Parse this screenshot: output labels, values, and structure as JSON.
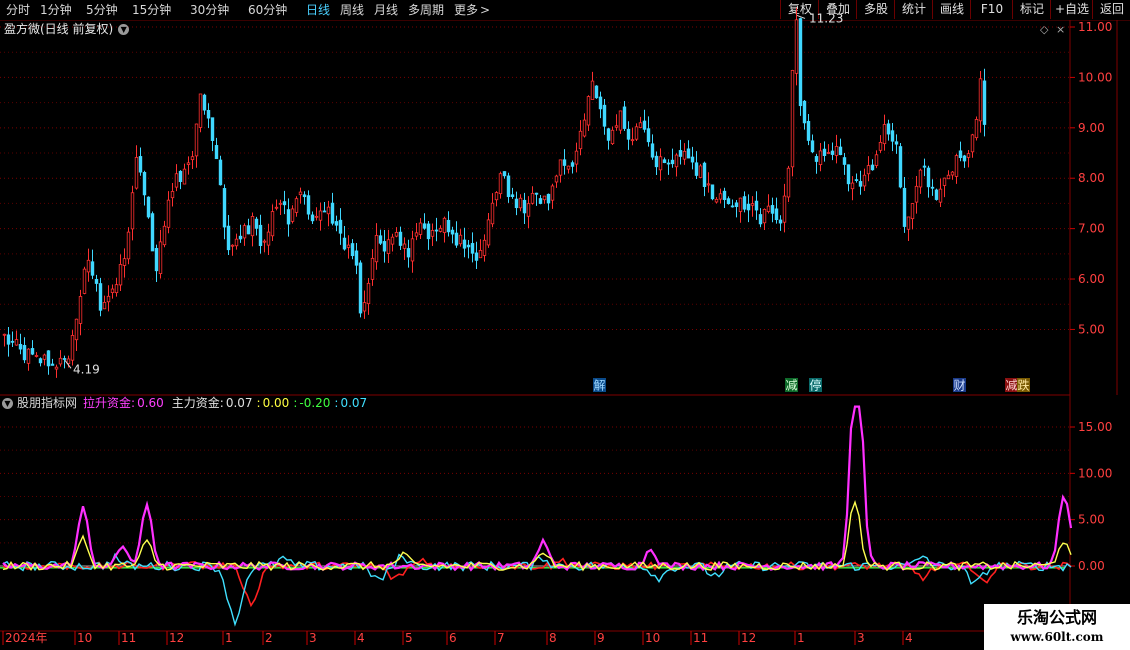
{
  "toolbar": {
    "periods": [
      "分时",
      "1分钟",
      "5分钟",
      "15分钟",
      "30分钟",
      "60分钟",
      "日线",
      "周线",
      "月线",
      "多周期",
      "更多"
    ],
    "active_period": "日线",
    "more_arrow": ">",
    "buttons": [
      "复权",
      "叠加",
      "多股",
      "统计",
      "画线",
      "F10",
      "标记",
      "+自选",
      "返回"
    ]
  },
  "main_panel": {
    "title": "盈方微(日线 前复权)",
    "price_high_label": "11.23",
    "price_low_label": "4.19",
    "event_markers": [
      {
        "label": "解",
        "bg": "#0a4a8a",
        "color": "#9fd8ff",
        "index": 149
      },
      {
        "label": "减",
        "bg": "#0e6a2a",
        "color": "#d8ffd8",
        "index": 197
      },
      {
        "label": "停",
        "bg": "#0a6a6a",
        "color": "#d8ffff",
        "index": 203
      },
      {
        "label": "财",
        "bg": "#1a3a8a",
        "color": "#cfe0ff",
        "index": 239
      },
      {
        "label": "减",
        "bg": "#8a1010",
        "color": "#ffd0d0",
        "index": 252
      },
      {
        "label": "跌",
        "bg": "#7a5a00",
        "color": "#ffe8a0",
        "index": 255
      }
    ]
  },
  "indicator_panel": {
    "name": "股朋指标网",
    "lashen_label": "拉升资金:",
    "lashen_value": "0.60",
    "zhuli_label": "主力资金:",
    "zhuli_value": "0.07",
    "sep1": ":",
    "v3": "0.00",
    "sep2": ":",
    "v4": "-0.20",
    "sep3": ":",
    "v5": "0.07"
  },
  "watermark": {
    "line1": "乐淘公式网",
    "line2": "www.60lt.com"
  },
  "chart_data": {
    "type": "candlestick",
    "axis_main": {
      "ticks": [
        "5.00",
        "6.00",
        "7.00",
        "8.00",
        "9.00",
        "10.00",
        "11.00"
      ],
      "ylim": [
        4.1,
        11.4
      ]
    },
    "axis_indicator": {
      "ticks": [
        "0.00",
        "5.00",
        "10.00",
        "15.00"
      ],
      "ylim": [
        -6.5,
        17.5
      ]
    },
    "x_labels": [
      "2024年",
      "10",
      "11",
      "12",
      "1",
      "2",
      "3",
      "4",
      "5",
      "6",
      "7",
      "8",
      "9",
      "10",
      "11",
      "12",
      "1",
      "3",
      "4"
    ],
    "x_label_index": [
      0,
      18,
      29,
      41,
      55,
      65,
      76,
      88,
      100,
      111,
      123,
      136,
      148,
      160,
      172,
      184,
      198,
      213,
      225
    ],
    "close_keys": [
      [
        0,
        4.85
      ],
      [
        4,
        4.55
      ],
      [
        8,
        4.4
      ],
      [
        12,
        4.38
      ],
      [
        15,
        4.3
      ],
      [
        17,
        4.8
      ],
      [
        19,
        5.7
      ],
      [
        21,
        6.4
      ],
      [
        24,
        5.5
      ],
      [
        28,
        5.9
      ],
      [
        31,
        6.8
      ],
      [
        33,
        8.4
      ],
      [
        36,
        7.2
      ],
      [
        38,
        6.2
      ],
      [
        41,
        7.6
      ],
      [
        44,
        8.1
      ],
      [
        47,
        8.6
      ],
      [
        49,
        9.7
      ],
      [
        51,
        9.2
      ],
      [
        54,
        7.8
      ],
      [
        56,
        6.6
      ],
      [
        59,
        6.8
      ],
      [
        62,
        7.1
      ],
      [
        65,
        6.7
      ],
      [
        68,
        7.5
      ],
      [
        71,
        7.2
      ],
      [
        74,
        7.7
      ],
      [
        77,
        7.3
      ],
      [
        80,
        7.4
      ],
      [
        83,
        7.1
      ],
      [
        86,
        6.6
      ],
      [
        88,
        6.1
      ],
      [
        89,
        5.2
      ],
      [
        91,
        6.0
      ],
      [
        93,
        6.8
      ],
      [
        95,
        6.5
      ],
      [
        98,
        6.9
      ],
      [
        101,
        6.5
      ],
      [
        104,
        7.2
      ],
      [
        107,
        6.8
      ],
      [
        110,
        7.1
      ],
      [
        113,
        6.8
      ],
      [
        116,
        6.6
      ],
      [
        118,
        6.5
      ],
      [
        121,
        7.1
      ],
      [
        124,
        8.1
      ],
      [
        127,
        7.5
      ],
      [
        130,
        7.4
      ],
      [
        133,
        7.6
      ],
      [
        136,
        7.5
      ],
      [
        139,
        8.3
      ],
      [
        142,
        8.4
      ],
      [
        145,
        9.2
      ],
      [
        147,
        9.9
      ],
      [
        149,
        9.4
      ],
      [
        151,
        8.6
      ],
      [
        154,
        9.2
      ],
      [
        157,
        8.8
      ],
      [
        160,
        9.0
      ],
      [
        163,
        8.3
      ],
      [
        166,
        8.2
      ],
      [
        169,
        8.5
      ],
      [
        172,
        8.3
      ],
      [
        175,
        8.0
      ],
      [
        178,
        7.5
      ],
      [
        181,
        7.6
      ],
      [
        184,
        7.5
      ],
      [
        187,
        7.4
      ],
      [
        189,
        7.2
      ],
      [
        192,
        7.4
      ],
      [
        194,
        7.2
      ],
      [
        196,
        8.2
      ],
      [
        197,
        10.2
      ],
      [
        198,
        11.0
      ],
      [
        199,
        9.6
      ],
      [
        200,
        9.0
      ],
      [
        202,
        8.5
      ],
      [
        205,
        8.4
      ],
      [
        208,
        8.6
      ],
      [
        210,
        8.3
      ],
      [
        212,
        7.8
      ],
      [
        215,
        8.0
      ],
      [
        218,
        8.3
      ],
      [
        220,
        9.0
      ],
      [
        223,
        8.6
      ],
      [
        225,
        7.2
      ],
      [
        227,
        7.5
      ],
      [
        229,
        8.3
      ],
      [
        231,
        7.8
      ],
      [
        233,
        7.5
      ],
      [
        236,
        8.0
      ],
      [
        238,
        8.5
      ],
      [
        240,
        8.2
      ],
      [
        242,
        8.8
      ],
      [
        244,
        9.8
      ],
      [
        245,
        9.1
      ]
    ],
    "series_indicator": [
      {
        "name": "拉升资金",
        "color": "#ff30ff",
        "peaks": [
          [
            20,
            6.2
          ],
          [
            30,
            2.2
          ],
          [
            36,
            6.7
          ],
          [
            135,
            2.6
          ],
          [
            162,
            2.0
          ],
          [
            213,
            16.2
          ],
          [
            214,
            11.5
          ],
          [
            265,
            5.2
          ],
          [
            266,
            3.2
          ]
        ]
      },
      {
        "name": "主力资金",
        "color": "#ffff50",
        "peaks": [
          [
            20,
            2.9
          ],
          [
            36,
            2.6
          ],
          [
            100,
            1.2
          ],
          [
            135,
            1.6
          ],
          [
            213,
            7.3
          ],
          [
            265,
            2.8
          ]
        ]
      }
    ]
  }
}
